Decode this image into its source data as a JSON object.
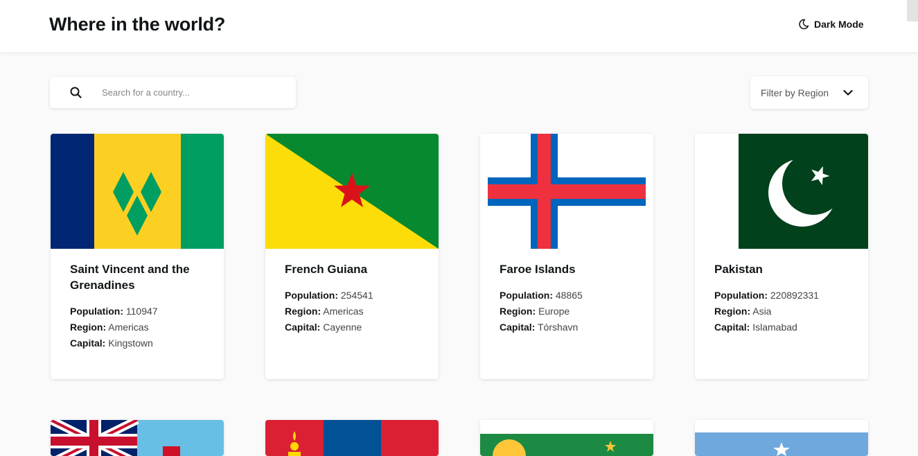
{
  "header": {
    "title": "Where in the world?",
    "dark_mode_label": "Dark Mode",
    "dark_mode_icon": "moon-icon"
  },
  "search": {
    "placeholder": "Search for a country...",
    "icon": "search-icon"
  },
  "filter": {
    "label": "Filter by Region",
    "icon": "chevron-down-icon"
  },
  "labels": {
    "population": "Population:",
    "region": "Region:",
    "capital": "Capital:"
  },
  "countries": [
    {
      "name": "Saint Vincent and the Grenadines",
      "population": "110947",
      "region": "Americas",
      "capital": "Kingstown",
      "flag": "saint-vincent-flag"
    },
    {
      "name": "French Guiana",
      "population": "254541",
      "region": "Americas",
      "capital": "Cayenne",
      "flag": "french-guiana-flag"
    },
    {
      "name": "Faroe Islands",
      "population": "48865",
      "region": "Europe",
      "capital": "Tórshavn",
      "flag": "faroe-islands-flag"
    },
    {
      "name": "Pakistan",
      "population": "220892331",
      "region": "Asia",
      "capital": "Islamabad",
      "flag": "pakistan-flag"
    }
  ],
  "second_row_flags": [
    "fiji-flag",
    "mongolia-flag",
    "christmas-island-flag",
    "somalia-flag"
  ],
  "colors": {
    "background": "#fafafa",
    "card": "#ffffff",
    "text": "#111517"
  }
}
